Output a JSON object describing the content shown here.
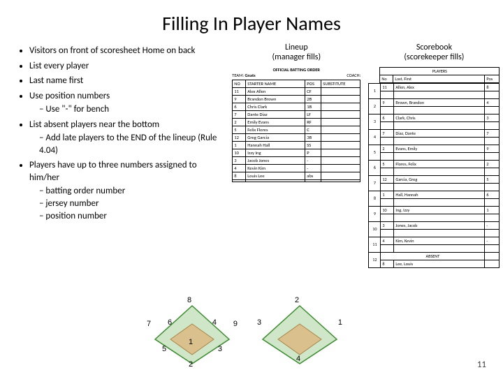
{
  "title": "Filling In Player Names",
  "bullets": {
    "b0": "Visitors on front of scoresheet Home on back",
    "b1": "List every player",
    "b2": "Last name first",
    "b3": "Use position numbers",
    "b3s0": "Use \"-\" for bench",
    "b4": "List absent players near the bottom",
    "b4s0": "Add late players to the END of the lineup (Rule 4.04)",
    "b5": "Players have up to three numbers assigned to him/her",
    "b5s0": "batting order number",
    "b5s1": "jersey number",
    "b5s2": "position number"
  },
  "mid": {
    "heading_l1": "Lineup",
    "heading_l2": "(manager fills)",
    "hdr_title": "OFFICIAL BATTING ORDER",
    "hdr_team_lbl": "TEAM:",
    "hdr_team_val": "Gnats",
    "hdr_coach_lbl": "COACH:",
    "col_no": "NO",
    "col_name": "STARTER NAME",
    "col_pos": "POS",
    "col_sub": "SUBSTITUTE",
    "rows": [
      {
        "no": "11",
        "name": "Alex Allen",
        "pos": "CF"
      },
      {
        "no": "9",
        "name": "Brandon Brown",
        "pos": "2B"
      },
      {
        "no": "6",
        "name": "Chris Clark",
        "pos": "1B"
      },
      {
        "no": "7",
        "name": "Dante Diaz",
        "pos": "LF"
      },
      {
        "no": "2",
        "name": "Emily Evans",
        "pos": "RF"
      },
      {
        "no": "5",
        "name": "Felix Flores",
        "pos": "C"
      },
      {
        "no": "12",
        "name": "Greg Garcia",
        "pos": "3B"
      },
      {
        "no": "1",
        "name": "Hannah Hall",
        "pos": "SS"
      },
      {
        "no": "10",
        "name": "Izzy Ing",
        "pos": "P"
      },
      {
        "no": "3",
        "name": "Jacob Jones",
        "pos": "-"
      },
      {
        "no": "4",
        "name": "Kevin Kim",
        "pos": "-"
      },
      {
        "no": "8",
        "name": "Louis Lee",
        "pos": "abs"
      },
      {
        "no": "",
        "name": "",
        "pos": ""
      }
    ]
  },
  "right": {
    "heading_l1": "Scorebook",
    "heading_l2": "(scorekeeper fills)",
    "top_players": "PLAYERS",
    "col_no": "No",
    "col_name": "Last, First",
    "col_pos": "Pos",
    "col_absent": "ABSENT",
    "rows": [
      {
        "ord": "1",
        "no": "11",
        "name": "Allen, Alex",
        "pos": "8"
      },
      {
        "ord": "2",
        "no": "9",
        "name": "Brown, Brandon",
        "pos": "4"
      },
      {
        "ord": "3",
        "no": "6",
        "name": "Clark, Chris",
        "pos": "3"
      },
      {
        "ord": "4",
        "no": "7",
        "name": "Diaz, Dante",
        "pos": "7"
      },
      {
        "ord": "5",
        "no": "2",
        "name": "Evans, Emily",
        "pos": "9"
      },
      {
        "ord": "6",
        "no": "5",
        "name": "Flores, Felix",
        "pos": "2"
      },
      {
        "ord": "7",
        "no": "12",
        "name": "Garcia, Greg",
        "pos": "5"
      },
      {
        "ord": "8",
        "no": "1",
        "name": "Hall, Hannah",
        "pos": "6"
      },
      {
        "ord": "9",
        "no": "10",
        "name": "Ing, Izzy",
        "pos": "1"
      },
      {
        "ord": "10",
        "no": "3",
        "name": "Jones, Jacob",
        "pos": "-"
      },
      {
        "ord": "11",
        "no": "4",
        "name": "Kim, Kevin",
        "pos": "-"
      },
      {
        "ord": "12",
        "no": "8",
        "name": "Lee, Louis",
        "pos": ""
      }
    ]
  },
  "diamond1": {
    "n1": "1",
    "n2": "2",
    "n3": "3",
    "n4": "4",
    "n5": "5",
    "n6": "6",
    "n7": "7",
    "n8": "8",
    "n9": "9"
  },
  "diamond2": {
    "n1": "1",
    "n2": "2",
    "n3": "3",
    "n4": "4"
  },
  "page_number": "11"
}
